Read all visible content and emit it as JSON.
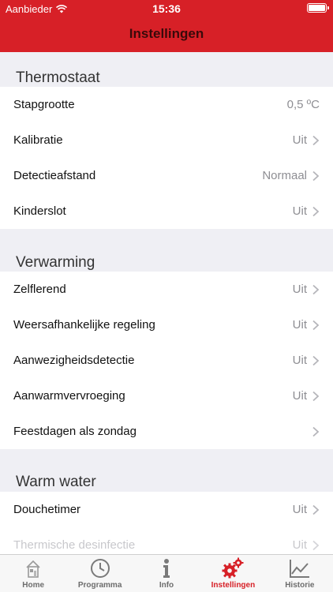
{
  "status_bar": {
    "carrier": "Aanbieder",
    "time": "15:36"
  },
  "header": {
    "title": "Instellingen"
  },
  "sections": [
    {
      "title": "Thermostaat",
      "rows": [
        {
          "label": "Stapgrootte",
          "value": "0,5 ºC"
        },
        {
          "label": "Kalibratie",
          "value": "Uit"
        },
        {
          "label": "Detectieafstand",
          "value": "Normaal"
        },
        {
          "label": "Kinderslot",
          "value": "Uit"
        }
      ]
    },
    {
      "title": "Verwarming",
      "rows": [
        {
          "label": "Zelflerend",
          "value": "Uit"
        },
        {
          "label": "Weersafhankelijke regeling",
          "value": "Uit"
        },
        {
          "label": "Aanwezigheidsdetectie",
          "value": "Uit"
        },
        {
          "label": "Aanwarmvervroeging",
          "value": "Uit"
        },
        {
          "label": "Feestdagen als zondag",
          "value": ""
        }
      ]
    },
    {
      "title": "Warm water",
      "rows": [
        {
          "label": "Douchetimer",
          "value": "Uit"
        },
        {
          "label": "Thermische desinfectie",
          "value": "Uit"
        }
      ]
    }
  ],
  "tabbar": {
    "items": [
      {
        "label": "Home",
        "icon": "home-icon"
      },
      {
        "label": "Programma",
        "icon": "clock-icon"
      },
      {
        "label": "Info",
        "icon": "info-icon"
      },
      {
        "label": "Instellingen",
        "icon": "gears-icon"
      },
      {
        "label": "Historie",
        "icon": "chart-icon"
      }
    ],
    "active_index": 3,
    "active_color": "#d72027"
  },
  "colors": {
    "brand": "#d72027",
    "background": "#efeff4"
  }
}
